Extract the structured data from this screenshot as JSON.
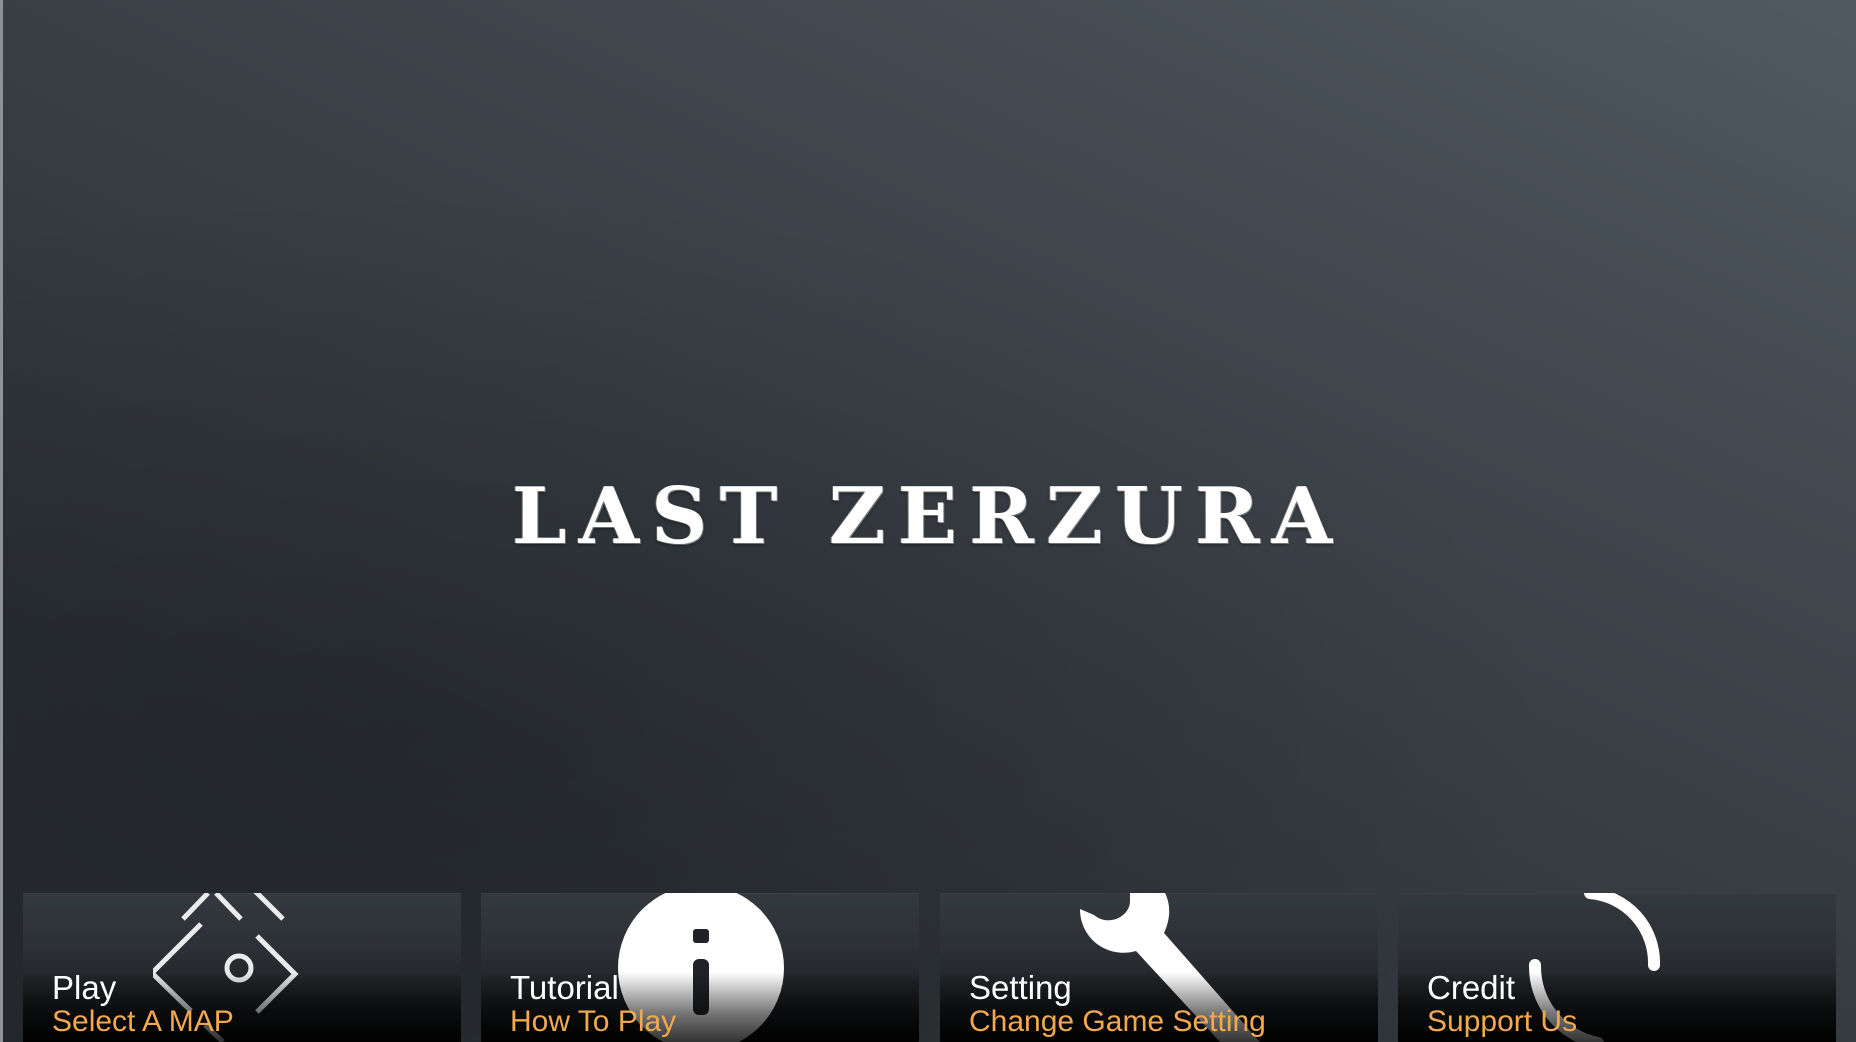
{
  "title": "LAST ZERZURA",
  "colors": {
    "title": "#ffffff",
    "label": "#ffffff",
    "sublabel": "#f2a94e"
  },
  "menu": [
    {
      "label": "Play",
      "sublabel": "Select A MAP",
      "icon": "compass-icon"
    },
    {
      "label": "Tutorial",
      "sublabel": "How To Play",
      "icon": "info-icon"
    },
    {
      "label": "Setting",
      "sublabel": "Change Game Setting",
      "icon": "wrench-icon"
    },
    {
      "label": "Credit",
      "sublabel": "Support Us",
      "icon": "refresh-arc-icon"
    }
  ]
}
